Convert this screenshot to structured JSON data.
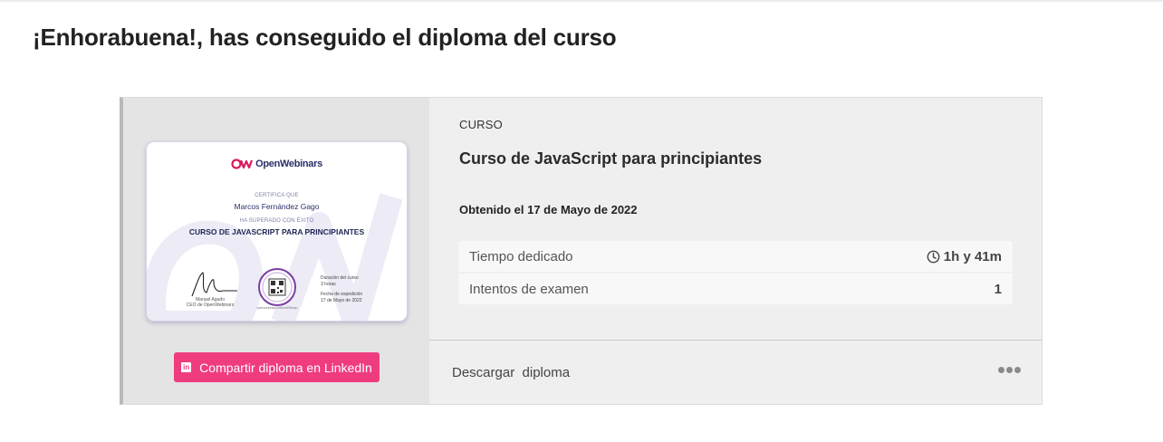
{
  "page": {
    "title": "¡Enhorabuena!, has conseguido el diploma del curso"
  },
  "certificate": {
    "brand": "OpenWebinars",
    "certifies_label": "CERTIFICA QUE",
    "recipient": "Marcos Fernández Gago",
    "passed_label": "HA SUPERADO CON ÉXITO",
    "course": "CURSO DE JAVASCRIPT PARA PRINCIPIANTES",
    "signer_name": "Manuel Agudo",
    "signer_role": "CEO de OpenWebinars",
    "duration_label": "Duración del curso",
    "duration_value": "3 horas",
    "issue_label": "Fecha de expedición",
    "issue_value": "17 de Mayo de 2022",
    "seal_text": "openwebinars.net/cert/Wwxp"
  },
  "share": {
    "linkedin_label": "Compartir diploma en LinkedIn",
    "linkedin_icon": "linkedin-icon"
  },
  "details": {
    "kicker": "CURSO",
    "course_title": "Curso de JavaScript para principiantes",
    "obtained": "Obtenido el 17 de Mayo de 2022",
    "stats": [
      {
        "label": "Tiempo dedicado",
        "value": "1h y 41m",
        "icon": "clock-icon"
      },
      {
        "label": "Intentos de examen",
        "value": "1"
      }
    ]
  },
  "actions": {
    "download_label": "Descargar  diploma",
    "more_icon": "more-dots-icon"
  },
  "colors": {
    "linkedin_button": "#ef3c7f",
    "brand_pink": "#c2185b",
    "brand_navy": "#2a2f6b"
  }
}
